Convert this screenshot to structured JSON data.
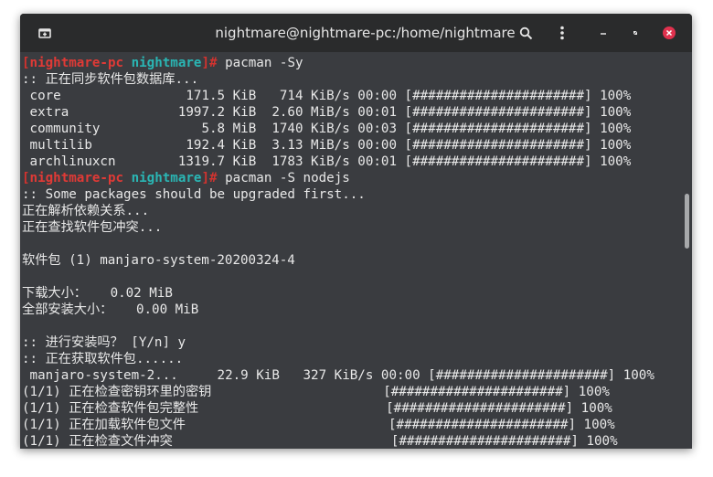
{
  "window": {
    "title": "nightmare@nightmare-pc:/home/nightmare",
    "colors": {
      "titlebar": "#2a2b2c",
      "terminal_bg": "#3a3c40",
      "prompt_red": "#e03a36",
      "prompt_teal": "#2ab6b4",
      "close": "#e0314e"
    },
    "icons": [
      "new-tab-icon",
      "search-icon",
      "menu-icon",
      "minimize-icon",
      "maximize-icon",
      "close-icon"
    ]
  },
  "terminal": {
    "lines": [
      {
        "type": "prompt",
        "host": "nightmare-pc",
        "dir": "nightmare",
        "cmd": "pacman -Sy"
      },
      {
        "type": "text",
        "text": ":: 正在同步软件包数据库..."
      },
      {
        "type": "text",
        "text": " core                171.5 KiB   714 KiB/s 00:00 [######################] 100%"
      },
      {
        "type": "text",
        "text": " extra              1997.2 KiB  2.60 MiB/s 00:01 [######################] 100%"
      },
      {
        "type": "text",
        "text": " community             5.8 MiB  1740 KiB/s 00:03 [######################] 100%"
      },
      {
        "type": "text",
        "text": " multilib            192.4 KiB  3.13 MiB/s 00:00 [######################] 100%"
      },
      {
        "type": "text",
        "text": " archlinuxcn        1319.7 KiB  1783 KiB/s 00:01 [######################] 100%"
      },
      {
        "type": "prompt",
        "host": "nightmare-pc",
        "dir": "nightmare",
        "cmd": "pacman -S nodejs"
      },
      {
        "type": "text",
        "text": ":: Some packages should be upgraded first..."
      },
      {
        "type": "text",
        "text": "正在解析依赖关系..."
      },
      {
        "type": "text",
        "text": "正在查找软件包冲突..."
      },
      {
        "type": "text",
        "text": ""
      },
      {
        "type": "text",
        "text": "软件包 (1) manjaro-system-20200324-4"
      },
      {
        "type": "text",
        "text": ""
      },
      {
        "type": "text",
        "text": "下载大小：   0.02 MiB"
      },
      {
        "type": "text",
        "text": "全部安装大小：   0.00 MiB"
      },
      {
        "type": "text",
        "text": ""
      },
      {
        "type": "text",
        "text": ":: 进行安装吗？ [Y/n] y"
      },
      {
        "type": "text",
        "text": ":: 正在获取软件包......"
      },
      {
        "type": "text",
        "text": " manjaro-system-2...     22.9 KiB   327 KiB/s 00:00 [######################] 100%"
      },
      {
        "type": "text",
        "text": "(1/1) 正在检查密钥环里的密钥                      [######################] 100%"
      },
      {
        "type": "text",
        "text": "(1/1) 正在检查软件包完整性                        [######################] 100%"
      },
      {
        "type": "text",
        "text": "(1/1) 正在加载软件包文件                          [######################] 100%"
      },
      {
        "type": "text",
        "text": "(1/1) 正在检查文件冲突                            [######################] 100%"
      }
    ]
  }
}
